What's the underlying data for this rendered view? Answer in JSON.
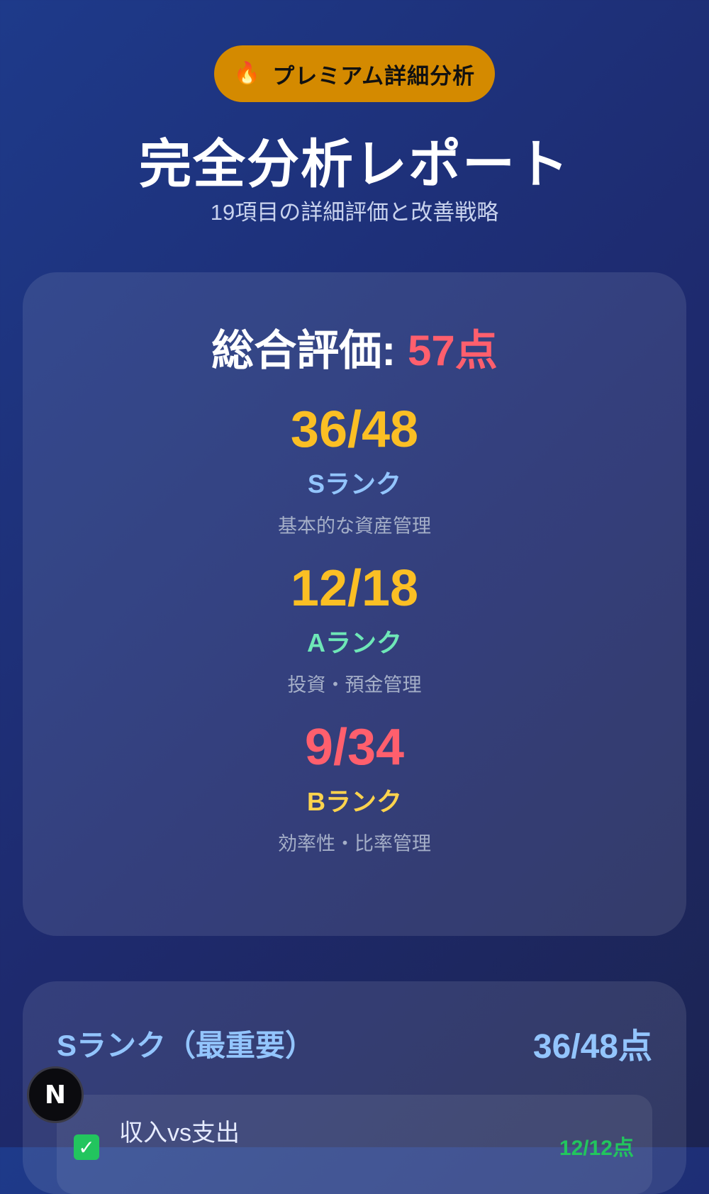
{
  "header": {
    "badge_icon": "flame-icon",
    "badge_label": "プレミアム詳細分析",
    "title": "完全分析レポート",
    "subtitle": "19項目の詳細評価と改善戦略"
  },
  "summary": {
    "overall_label": "総合評価: ",
    "overall_score": "57点",
    "ranks": [
      {
        "score": "36/48",
        "name": "Sランク",
        "desc": "基本的な資産管理",
        "score_color": "#fbbf24",
        "name_color": "#93c5fd"
      },
      {
        "score": "12/18",
        "name": "Aランク",
        "desc": "投資・預金管理",
        "score_color": "#fbbf24",
        "name_color": "#6ee7b7"
      },
      {
        "score": "9/34",
        "name": "Bランク",
        "desc": "効率性・比率管理",
        "score_color": "#ff5f6d",
        "name_color": "#fcd34d"
      }
    ]
  },
  "s_section": {
    "label": "Sランク（最重要）",
    "points": "36/48点",
    "items": [
      {
        "name": "収入vs支出",
        "value": "12/12点",
        "icon": "check-icon"
      }
    ]
  },
  "floating": {
    "badge_letter": "N"
  },
  "colors": {
    "accent_badge": "#d48a00",
    "overall_score": "#ff5f6d",
    "success": "#22c55e"
  }
}
